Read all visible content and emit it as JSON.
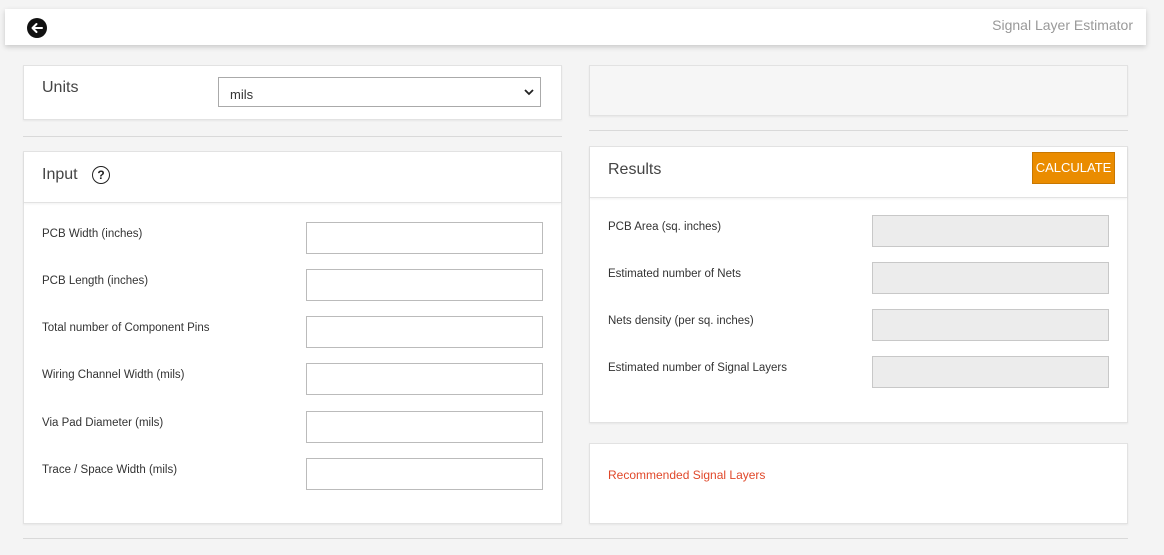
{
  "header": {
    "title": "Signal Layer Estimator",
    "back_icon": "arrow-left-icon"
  },
  "units": {
    "label": "Units",
    "selected": "mils"
  },
  "input": {
    "title": "Input",
    "help_glyph": "?",
    "fields": [
      {
        "label": "PCB Width (inches)",
        "value": ""
      },
      {
        "label": "PCB Length (inches)",
        "value": ""
      },
      {
        "label": "Total number of Component Pins",
        "value": ""
      },
      {
        "label": "Wiring Channel Width (mils)",
        "value": ""
      },
      {
        "label": "Via Pad Diameter (mils)",
        "value": ""
      },
      {
        "label": "Trace / Space Width (mils)",
        "value": ""
      }
    ]
  },
  "results": {
    "title": "Results",
    "calculate_label": "CALCULATE",
    "fields": [
      {
        "label": "PCB Area (sq. inches)",
        "value": ""
      },
      {
        "label": "Estimated number of Nets",
        "value": ""
      },
      {
        "label": "Nets density (per sq. inches)",
        "value": ""
      },
      {
        "label": "Estimated number of Signal Layers",
        "value": ""
      }
    ]
  },
  "recommendation": {
    "label": "Recommended Signal Layers"
  },
  "colors": {
    "accent": "#ea8c00",
    "warning_text": "#e0482a",
    "background": "#f4f4f4"
  }
}
